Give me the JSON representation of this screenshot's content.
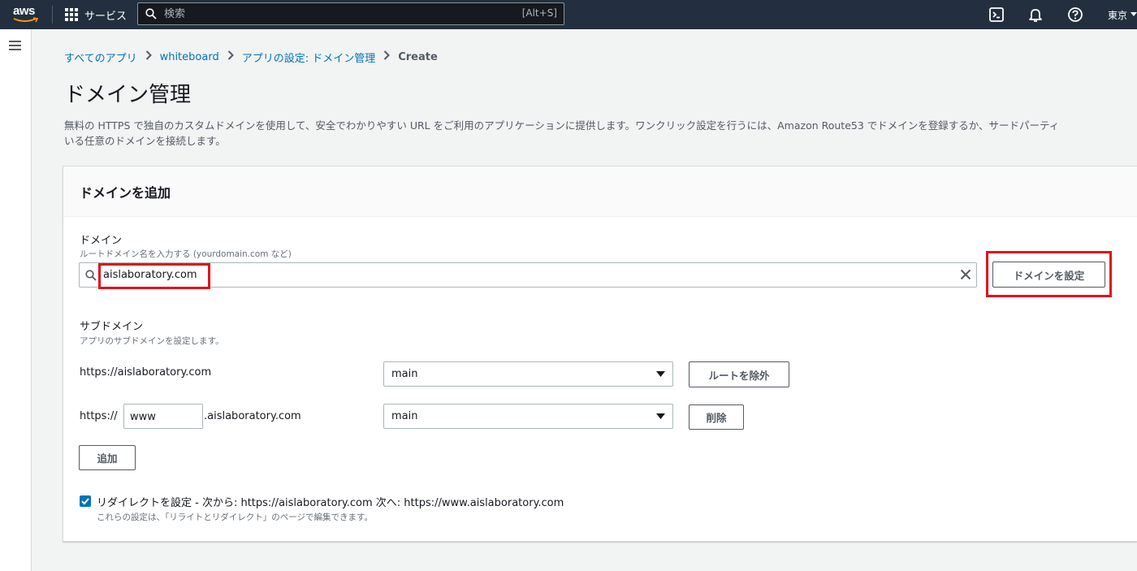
{
  "topnav": {
    "logo": "aws",
    "services_label": "サービス",
    "search_placeholder": "検索",
    "search_shortcut": "[Alt+S]",
    "region": "東京"
  },
  "breadcrumb": {
    "items": [
      "すべてのアプリ",
      "whiteboard",
      "アプリの設定: ドメイン管理"
    ],
    "current": "Create"
  },
  "page": {
    "title": "ドメイン管理",
    "description_line1": "無料の HTTPS で独自のカスタムドメインを使用して、安全でわかりやすい URL をご利用のアプリケーションに提供します。ワンクリック設定を行うには、Amazon Route53 でドメインを登録するか、サードパーティ",
    "description_line2": "いる任意のドメインを接続します。"
  },
  "panel": {
    "title": "ドメインを追加",
    "domain": {
      "label": "ドメイン",
      "hint": "ルートドメイン名を入力する (yourdomain.com など)",
      "value": "aislaboratory.com",
      "configure_button": "ドメインを設定"
    },
    "subdomain": {
      "label": "サブドメイン",
      "hint": "アプリのサブドメインを設定します。",
      "rows": [
        {
          "prefix": "https://aislaboratory.com",
          "branch": "main",
          "action": "ルートを除外"
        },
        {
          "prefix": "https://",
          "sub_value": "www",
          "suffix": ".aislaboratory.com",
          "branch": "main",
          "action": "削除"
        }
      ],
      "add_button": "追加"
    },
    "redirect": {
      "checked": true,
      "label": "リダイレクトを設定 - 次から: https://aislaboratory.com 次へ: https://www.aislaboratory.com",
      "hint": "これらの設定は、「リライトとリダイレクト」のページで編集できます。"
    }
  },
  "colors": {
    "nav_bg": "#232f3e",
    "link": "#0073bb",
    "highlight": "#e0111c",
    "checkbox": "#0073bb"
  }
}
